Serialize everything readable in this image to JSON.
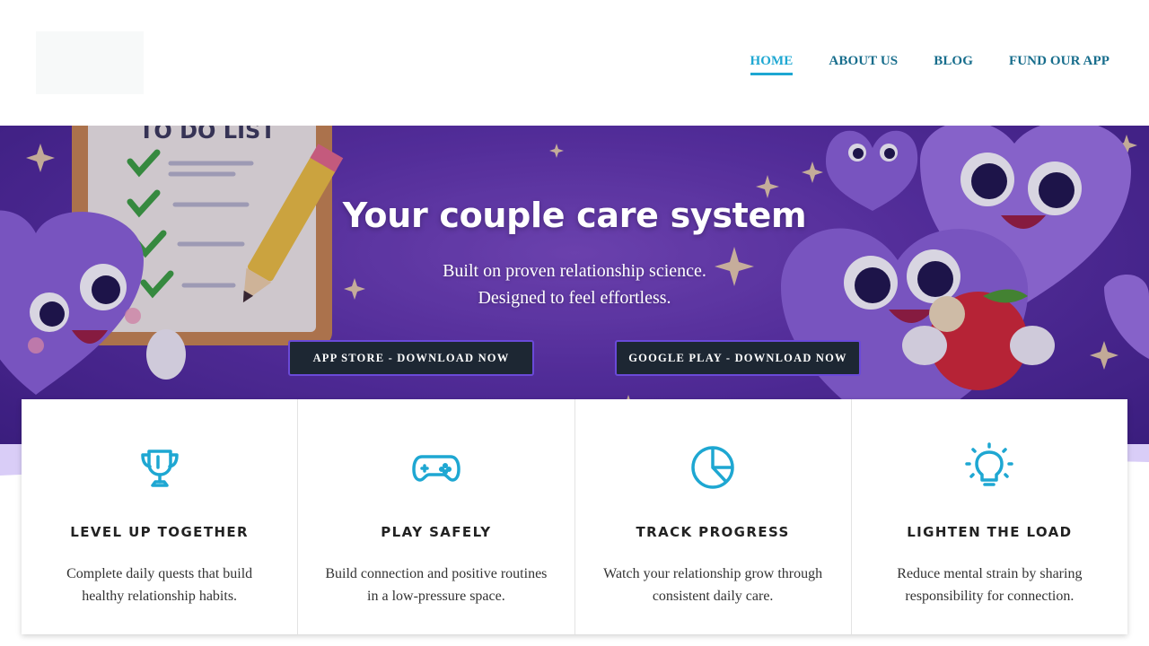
{
  "nav": {
    "items": [
      {
        "label": "HOME",
        "active": true
      },
      {
        "label": "ABOUT US",
        "active": false
      },
      {
        "label": "BLOG",
        "active": false
      },
      {
        "label": "FUND OUR APP",
        "active": false
      }
    ]
  },
  "hero": {
    "title": "Your couple care system",
    "subtitle_line1": "Built on proven relationship science.",
    "subtitle_line2": "Designed to feel effortless.",
    "clipboard_text": "TO DO LIST",
    "buttons": {
      "appstore": "APP STORE - DOWNLOAD NOW",
      "googleplay": "GOOGLE PLAY - DOWNLOAD NOW"
    }
  },
  "features": [
    {
      "icon": "trophy-icon",
      "title": "LEVEL UP TOGETHER",
      "desc": "Complete daily quests that build healthy relationship habits."
    },
    {
      "icon": "gamepad-icon",
      "title": "PLAY SAFELY",
      "desc": "Build connection and positive routines in a low-pressure space."
    },
    {
      "icon": "pie-chart-icon",
      "title": "TRACK PROGRESS",
      "desc": "Watch your relationship grow through consistent daily care."
    },
    {
      "icon": "lightbulb-icon",
      "title": "LIGHTEN THE LOAD",
      "desc": "Reduce mental strain by sharing responsibility for connection."
    }
  ],
  "colors": {
    "accent": "#1ea7d2",
    "nav_text": "#176d8c",
    "hero_purple": "#5b31a6",
    "button_bg": "#1d2733",
    "button_border": "#6a4ad8"
  }
}
